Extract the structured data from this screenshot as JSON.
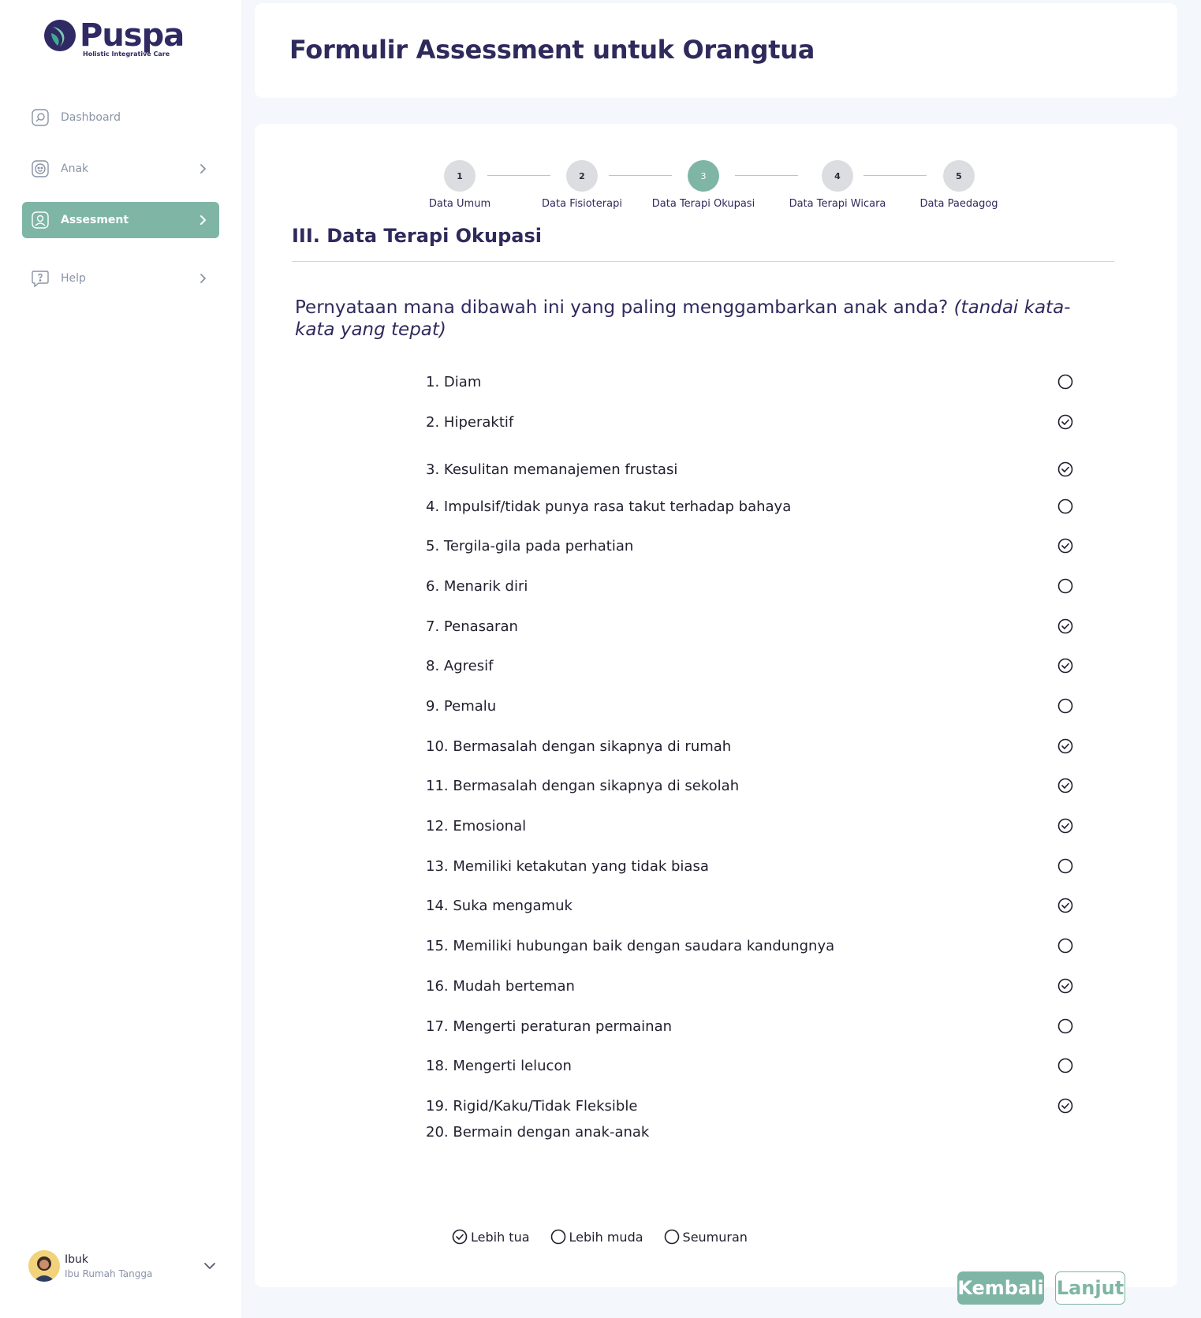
{
  "brand": {
    "name": "Puspa",
    "tagline": "Holistic Integrative Care",
    "accent": "#7fb5a4",
    "dark": "#2f2a63"
  },
  "sidebar": {
    "items": [
      {
        "label": "Dashboard",
        "icon": "dashboard-icon",
        "chevron": false,
        "active": false
      },
      {
        "label": "Anak",
        "icon": "child-face-icon",
        "chevron": true,
        "active": false
      },
      {
        "label": "Assesment",
        "icon": "user-profile-icon",
        "chevron": true,
        "active": true
      },
      {
        "label": "Help",
        "icon": "help-chat-icon",
        "chevron": true,
        "active": false
      }
    ],
    "user": {
      "name": "Ibuk",
      "role": "Ibu Rumah Tangga"
    }
  },
  "header": {
    "title": "Formulir Assessment untuk Orangtua"
  },
  "stepper": {
    "steps": [
      {
        "num": "1",
        "label": "Data Umum"
      },
      {
        "num": "2",
        "label": "Data Fisioterapi"
      },
      {
        "num": "3",
        "label": "Data Terapi Okupasi"
      },
      {
        "num": "4",
        "label": "Data Terapi Wicara"
      },
      {
        "num": "5",
        "label": "Data Paedagog"
      }
    ],
    "active_step": 3
  },
  "section": {
    "title": "III. Data Terapi Okupasi",
    "question": "Pernyataan mana dibawah ini yang paling menggambarkan anak anda?",
    "question_hint": "(tandai kata-kata yang tepat)"
  },
  "items": [
    {
      "num": "1.",
      "text": "Diam",
      "checked": false
    },
    {
      "num": "2.",
      "text": "Hiperaktif",
      "checked": true
    },
    {
      "num": "3.",
      "text": "Kesulitan memanajemen frustasi",
      "checked": true
    },
    {
      "num": "4.",
      "text": "Impulsif/tidak punya rasa takut terhadap bahaya",
      "checked": false
    },
    {
      "num": "5.",
      "text": "Tergila-gila pada perhatian",
      "checked": true
    },
    {
      "num": "6.",
      "text": "Menarik diri",
      "checked": false
    },
    {
      "num": "7.",
      "text": "Penasaran",
      "checked": true
    },
    {
      "num": "8.",
      "text": "Agresif",
      "checked": true
    },
    {
      "num": "9.",
      "text": "Pemalu",
      "checked": false
    },
    {
      "num": "10.",
      "text": "Bermasalah dengan sikapnya di rumah",
      "checked": true
    },
    {
      "num": "11.",
      "text": "Bermasalah dengan sikapnya di sekolah",
      "checked": true
    },
    {
      "num": "12.",
      "text": "Emosional",
      "checked": true
    },
    {
      "num": "13.",
      "text": "Memiliki ketakutan yang tidak biasa",
      "checked": false
    },
    {
      "num": "14.",
      "text": "Suka mengamuk",
      "checked": true
    },
    {
      "num": "15.",
      "text": "Memiliki hubungan baik dengan saudara kandungnya",
      "checked": false
    },
    {
      "num": "16.",
      "text": "Mudah berteman",
      "checked": true
    },
    {
      "num": "17.",
      "text": "Mengerti peraturan permainan",
      "checked": false
    },
    {
      "num": "18.",
      "text": "Mengerti lelucon",
      "checked": false
    },
    {
      "num": "19.",
      "text": "Rigid/Kaku/Tidak Fleksible",
      "checked": true
    }
  ],
  "item20": {
    "num": "20.",
    "text": "Bermain dengan anak-anak",
    "options": [
      {
        "label": "Lebih tua",
        "checked": true
      },
      {
        "label": "Lebih muda",
        "checked": false
      },
      {
        "label": "Seumuran",
        "checked": false
      }
    ]
  },
  "buttons": {
    "back": "Kembali",
    "next": "Lanjut"
  }
}
